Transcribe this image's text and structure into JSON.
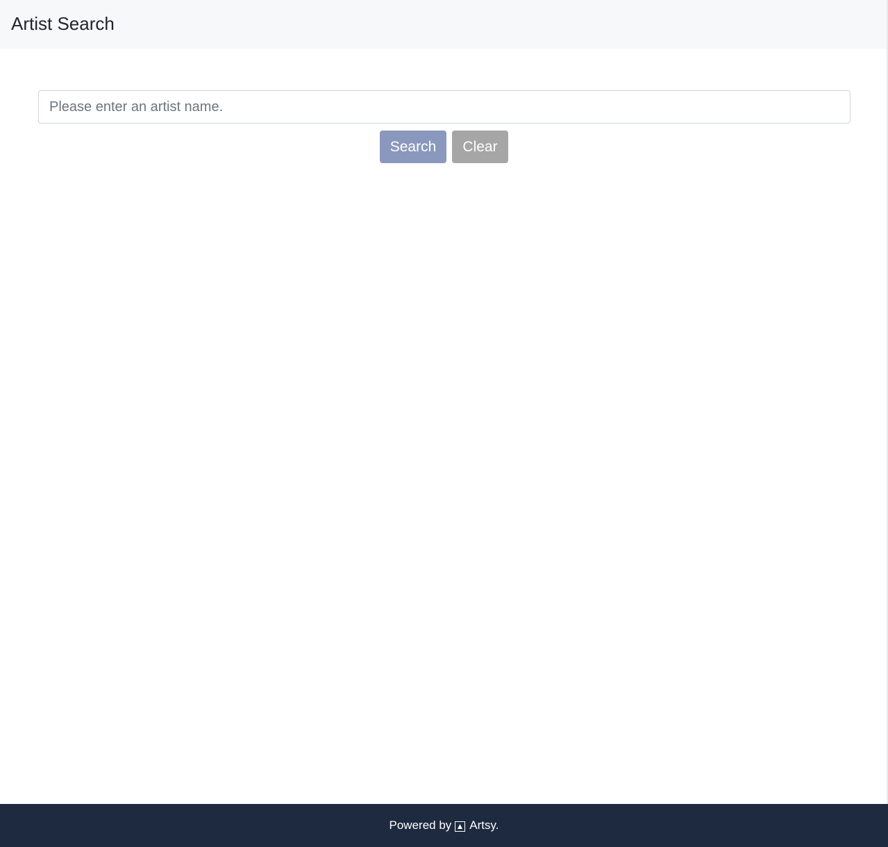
{
  "navbar": {
    "brand": "Artist Search"
  },
  "search": {
    "placeholder": "Please enter an artist name.",
    "value": "",
    "search_label": "Search",
    "clear_label": "Clear"
  },
  "footer": {
    "prefix": "Powered by",
    "brand": "Artsy."
  },
  "colors": {
    "navbar_bg": "#f7f8f9",
    "search_button": "#8a98bd",
    "clear_button": "#a6a6a6",
    "footer_bg": "#1e2a40"
  },
  "icons": {
    "footer_logo": "artsy-logo-icon"
  }
}
